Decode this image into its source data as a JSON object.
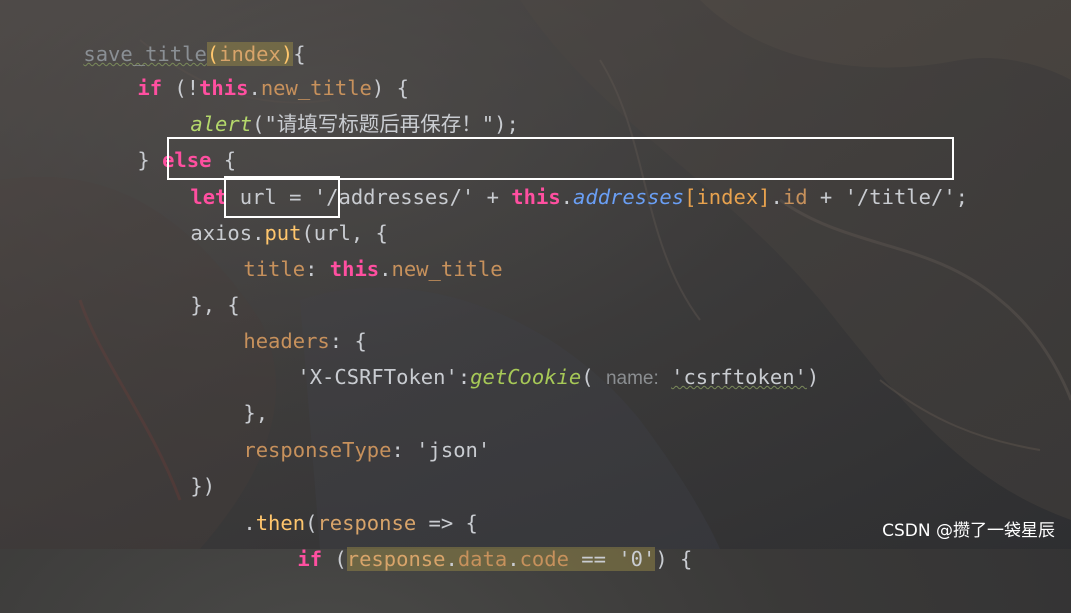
{
  "code": {
    "l1": {
      "name": "save_title",
      "open": "(",
      "param": "index",
      "close": ")",
      "brace": "{"
    },
    "l2": {
      "kw": "if",
      "a": " (!",
      "this": "this",
      "dot": ".",
      "field": "new_title",
      "b": ") {"
    },
    "l3": {
      "fn": "alert",
      "a": "(",
      "str": "\"请填写标题后再保存！\"",
      "b": ");"
    },
    "l4": {
      "a": "} ",
      "kw": "else",
      "b": " {"
    },
    "l5": {
      "kw": "let",
      "a": " url = ",
      "s1": "'/addresses/'",
      "b": " + ",
      "this": "this",
      "dot": ".",
      "field": "addresses",
      "lb": "[",
      "idx": "index",
      "rb": "]",
      "dot2": ".",
      "id": "id",
      "c": " + ",
      "s2": "'/title/'",
      "end": ";"
    },
    "l6": {
      "a": "axios.",
      "fn": "put",
      "b": "(url, {"
    },
    "l7": {
      "key": "title",
      "a": ": ",
      "this": "this",
      "dot": ".",
      "field": "new_title"
    },
    "l8": {
      "text": "}, {"
    },
    "l9": {
      "key": "headers",
      "a": ": {"
    },
    "l10": {
      "s1": "'X-CSRFToken'",
      "a": ":",
      "fn": "getCookie",
      "b": "( ",
      "hint": "name:",
      "s2": "'csrftoken'",
      "c": ")"
    },
    "l11": {
      "text": "},"
    },
    "l12": {
      "key": "responseType",
      "a": ": ",
      "str": "'json'"
    },
    "l13": {
      "text": "})"
    },
    "l14": {
      "a": ".",
      "fn": "then",
      "b": "(",
      "param": "response",
      "c": " => {"
    },
    "l15": {
      "kw": "if",
      "a": " (",
      "param": "response",
      "dot": ".",
      "field": "data",
      "dot2": ".",
      "code": "code",
      "op": " == ",
      "str": "'0'",
      "b": ") {"
    }
  },
  "watermark": "CSDN @攒了一袋星辰"
}
